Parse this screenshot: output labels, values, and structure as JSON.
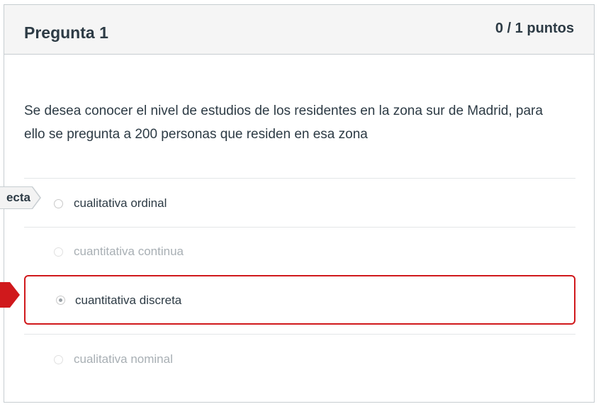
{
  "question": {
    "title": "Pregunta 1",
    "points": "0 / 1 puntos",
    "text": "Se desea conocer el nivel de estudios de los residentes en la zona sur de Madrid, para ello se pregunta a 200 personas que residen en esa zona"
  },
  "flags": {
    "correct_label": "ecta",
    "correct_color": "#f3f3f3",
    "wrong_color": "#d0191c"
  },
  "answers": [
    {
      "label": "cualitativa ordinal",
      "state": "correct-answer"
    },
    {
      "label": "cuantitativa continua",
      "state": "unselected"
    },
    {
      "label": "cuantitativa discreta",
      "state": "selected-wrong"
    },
    {
      "label": "cualitativa nominal",
      "state": "unselected"
    }
  ]
}
